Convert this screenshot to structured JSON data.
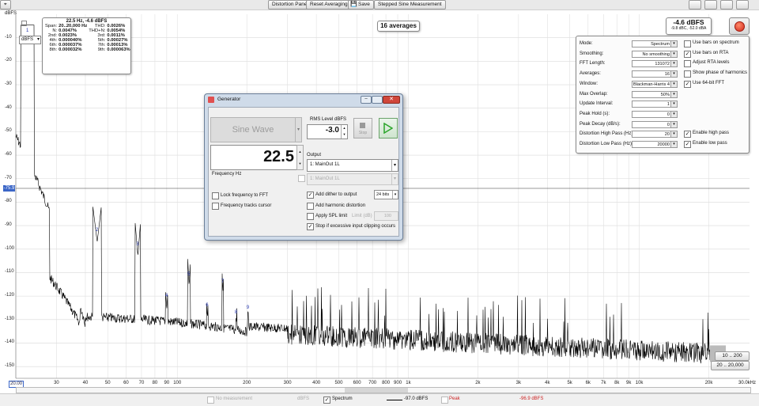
{
  "toolbar": {
    "distortion_panel": "Distortion Panel",
    "reset_averaging": "Reset Averaging",
    "save": "Save",
    "stepped_sine": "Stepped Sine Measurement"
  },
  "plot": {
    "y_unit": "dBFS",
    "y_ticks": [
      "-10",
      "-20",
      "-30",
      "-40",
      "-50",
      "-60",
      "-70",
      "-80",
      "-90",
      "-100",
      "-110",
      "-120",
      "-130",
      "-140",
      "-150"
    ],
    "x_ticks": [
      "30",
      "40",
      "50",
      "60",
      "70",
      "80",
      "90",
      "100",
      "200",
      "300",
      "400",
      "500",
      "600",
      "700",
      "800",
      "900",
      "1k",
      "2k",
      "3k",
      "4k",
      "5k",
      "6k",
      "7k",
      "8k",
      "9k",
      "10k",
      "20k"
    ],
    "x_start": "20.00",
    "x_end": "30.0kHz",
    "cursor_value": "-75.9",
    "averages_badge": "16 averages",
    "harmonic_labels": [
      "1",
      "2",
      "3",
      "4",
      "5",
      "6",
      "7",
      "8",
      "9"
    ],
    "dbfs_selector": "dBFS",
    "range_buttons": [
      "10 .. 200",
      "20 .. 20,000"
    ]
  },
  "readout": {
    "title": "22.5 Hz, -4.6 dBFS",
    "rows": [
      {
        "k1": "Span:",
        "v1": "20..20,000 Hz",
        "k2": "THD:",
        "v2": "0.0026%"
      },
      {
        "k1": "N:",
        "v1": "0.0047%",
        "k2": "THD+N:",
        "v2": "0.0054%"
      },
      {
        "k1": "2nd:",
        "v1": "0.0023%",
        "k2": "3rd:",
        "v2": "0.0011%"
      },
      {
        "k1": "4th:",
        "v1": "0.000040%",
        "k2": "5th:",
        "v2": "0.00027%"
      },
      {
        "k1": "6th:",
        "v1": "0.000037%",
        "k2": "7th:",
        "v2": "0.00013%"
      },
      {
        "k1": "8th:",
        "v1": "0.000032%",
        "k2": "9th:",
        "v2": "0.000063%"
      }
    ]
  },
  "level_meter": {
    "main": "-4.6 dBFS",
    "sub": "-9.8 dBC, -52.0 dBA"
  },
  "controls": {
    "rows": [
      {
        "label": "Mode:",
        "value": "Spectrum"
      },
      {
        "label": "Smoothing:",
        "value": "No smoothing"
      },
      {
        "label": "FFT Length:",
        "value": "131072"
      },
      {
        "label": "Averages:",
        "value": "16"
      },
      {
        "label": "Window:",
        "value": "Blackman-Harris 4"
      },
      {
        "label": "Max Overlap:",
        "value": "50%"
      },
      {
        "label": "Update Interval:",
        "value": "1"
      },
      {
        "label": "Peak Hold (s):",
        "value": "0"
      },
      {
        "label": "Peak Decay (dB/s):",
        "value": "0"
      },
      {
        "label": "Distortion High Pass (Hz):",
        "value": "20"
      },
      {
        "label": "Distortion Low Pass (Hz):",
        "value": "20000"
      }
    ],
    "checks": [
      {
        "label": "Use bars on spectrum",
        "checked": false
      },
      {
        "label": "Use bars on RTA",
        "checked": true
      },
      {
        "label": "Adjust RTA levels",
        "checked": false
      },
      {
        "label": "Show phase of harmonics",
        "checked": false
      },
      {
        "label": "Use 64-bit FFT",
        "checked": true
      }
    ],
    "checks2": [
      {
        "label": "Enable high pass",
        "checked": true
      },
      {
        "label": "Enable low pass",
        "checked": true
      }
    ]
  },
  "generator": {
    "title": "Generator",
    "signal": "Sine Wave",
    "rms_label": "RMS Level dBFS",
    "rms_value": "-3.0",
    "frequency": "22.5",
    "frequency_label": "Frequency Hz",
    "output_label": "Output",
    "output_value": "1: MainOut 1L",
    "output_value2": "1: MainOut 1L",
    "lock_freq": "Lock frequency to FFT",
    "tracks_cursor": "Frequency tracks cursor",
    "add_dither": "Add dither to output",
    "dither_bits": "24 bits",
    "add_harm": "Add harmonic distortion",
    "apply_spl": "Apply SPL limit",
    "spl_label": "Limit (dB)",
    "spl_value": "100",
    "stop_clip": "Stop if excessive input clipping occurs",
    "stop_btn": "Stop"
  },
  "footer": {
    "no_measurement": "No measurement",
    "dbfs": "dBFS",
    "spectrum": "Spectrum",
    "spectrum_value": "-97.0 dBFS",
    "peak": "Peak",
    "peak_value": "-96.9 dBFS"
  },
  "colors": {
    "harmonic_label": "#2233aa",
    "peak_red": "#cc2222",
    "generator_frame": "#cfdbe9",
    "play_green": "#2aa52a"
  }
}
